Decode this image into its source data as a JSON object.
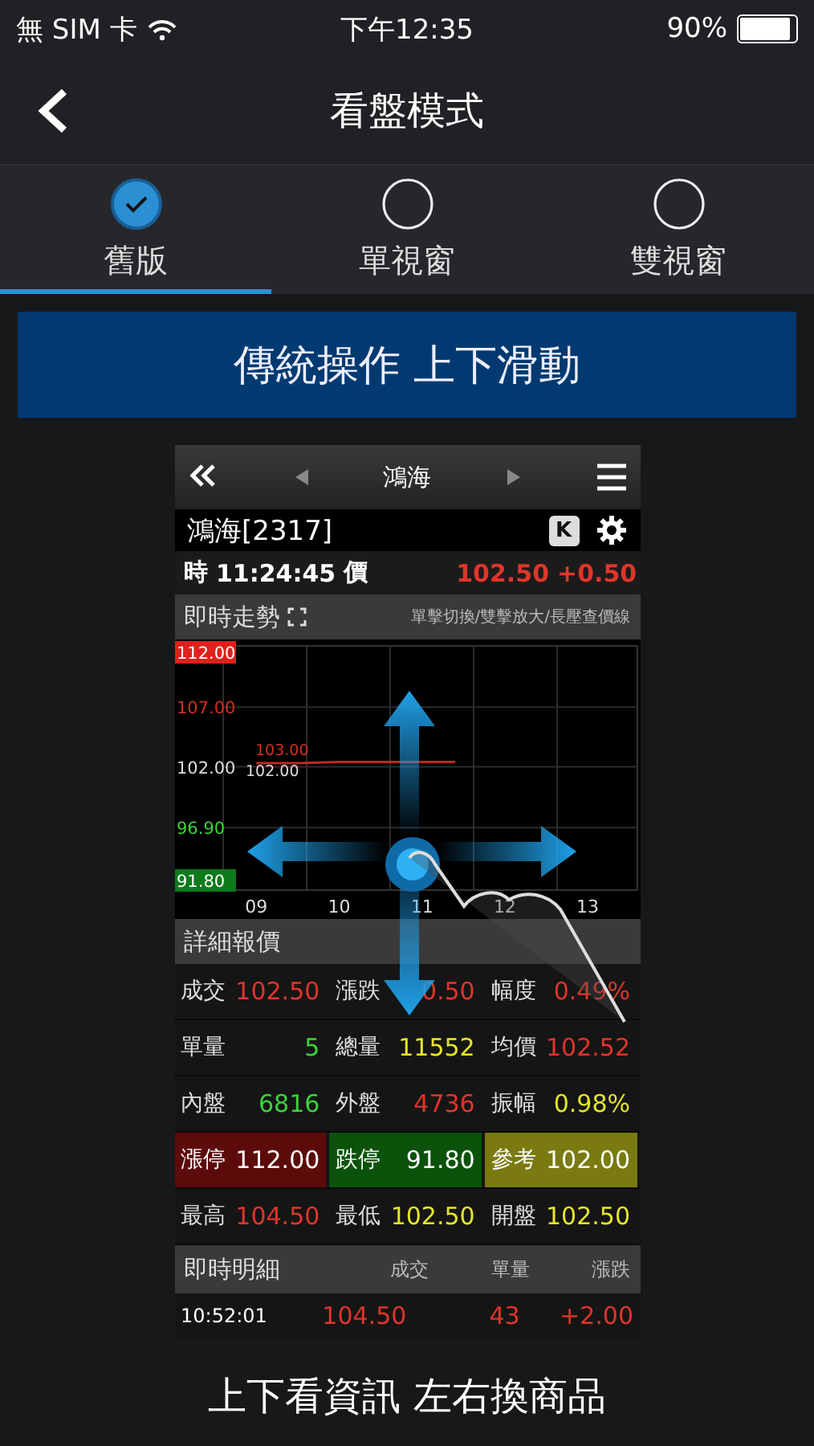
{
  "status_bar": {
    "carrier": "無 SIM 卡",
    "time": "下午12:35",
    "battery": "90%"
  },
  "nav": {
    "title": "看盤模式"
  },
  "tabs": [
    {
      "label": "舊版",
      "selected": true
    },
    {
      "label": "單視窗",
      "selected": false
    },
    {
      "label": "雙視窗",
      "selected": false
    }
  ],
  "banner": "傳統操作 上下滑動",
  "preview": {
    "top_bar": {
      "title": "鴻海"
    },
    "stock": "鴻海[2317]",
    "k_button": "K",
    "quote": {
      "time_label": "時",
      "time": "11:24:45",
      "price_label": "價",
      "price": "102.50",
      "change": "+0.50"
    },
    "trend_header": {
      "title": "即時走勢",
      "hint": "單擊切換/雙擊放大/長壓查價線"
    },
    "chart_data": {
      "type": "line",
      "x": [
        9,
        9.5,
        10,
        10.5,
        11,
        11.4
      ],
      "series": [
        {
          "color": "#c0281c",
          "values": [
            102.3,
            102.3,
            102.4,
            102.4,
            102.4,
            102.4
          ]
        }
      ],
      "xlim": [
        8.6,
        13.6
      ],
      "grid": true,
      "ylim": [
        91.8,
        112
      ],
      "xticks": [
        {
          "value": 9,
          "label": "09"
        },
        {
          "value": 10,
          "label": "10"
        },
        {
          "value": 11,
          "label": "11"
        },
        {
          "value": 12,
          "label": "12"
        },
        {
          "value": 13,
          "label": "13"
        }
      ],
      "yticks": [
        {
          "value": 112,
          "label": "112.00"
        },
        {
          "value": 107,
          "label": "107.00"
        },
        {
          "value": 102,
          "label": "102.00"
        },
        {
          "value": 96.9,
          "label": "96.90"
        },
        {
          "value": 91.8,
          "label": "91.80"
        }
      ],
      "annotations": [
        "103.00",
        "102.00"
      ]
    },
    "detail_header": "詳細報價",
    "detail_rows": [
      [
        {
          "kind": "plain",
          "label": "成交",
          "value": "102.50",
          "color": "#e0352a"
        },
        {
          "kind": "plain",
          "label": "漲跌",
          "value": "0.50",
          "color": "#e0352a"
        },
        {
          "kind": "plain",
          "label": "幅度",
          "value": "0.49%",
          "color": "#e0352a"
        }
      ],
      [
        {
          "kind": "plain",
          "label": "單量",
          "value": "5",
          "color": "#3cd23c"
        },
        {
          "kind": "plain",
          "label": "總量",
          "value": "11552",
          "color": "#e6e62a"
        },
        {
          "kind": "plain",
          "label": "均價",
          "value": "102.52",
          "color": "#e0352a"
        }
      ],
      [
        {
          "kind": "plain",
          "label": "內盤",
          "value": "6816",
          "color": "#3cd23c"
        },
        {
          "kind": "plain",
          "label": "外盤",
          "value": "4736",
          "color": "#e0352a"
        },
        {
          "kind": "plain",
          "label": "振幅",
          "value": "0.98%",
          "color": "#e6e62a"
        }
      ],
      [
        {
          "kind": "filled",
          "label": "漲停",
          "value": "112.00",
          "color": "#5c0a0a"
        },
        {
          "kind": "filled",
          "label": "跌停",
          "value": "91.80",
          "color": "#0b520b"
        },
        {
          "kind": "filled",
          "label": "參考",
          "value": "102.00",
          "color": "#7a7a10"
        }
      ],
      [
        {
          "kind": "plain",
          "label": "最高",
          "value": "104.50",
          "color": "#e0352a"
        },
        {
          "kind": "plain",
          "label": "最低",
          "value": "102.50",
          "color": "#e6e62a"
        },
        {
          "kind": "plain",
          "label": "開盤",
          "value": "102.50",
          "color": "#e6e62a"
        }
      ]
    ],
    "ticks": {
      "title": "即時明細",
      "columns": [
        "成交",
        "單量",
        "漲跌"
      ],
      "rows": [
        {
          "time": "10:52:01",
          "price": "104.50",
          "volume": "43",
          "change": "+2.00"
        }
      ]
    }
  },
  "caption": "上下看資訊 左右換商品"
}
